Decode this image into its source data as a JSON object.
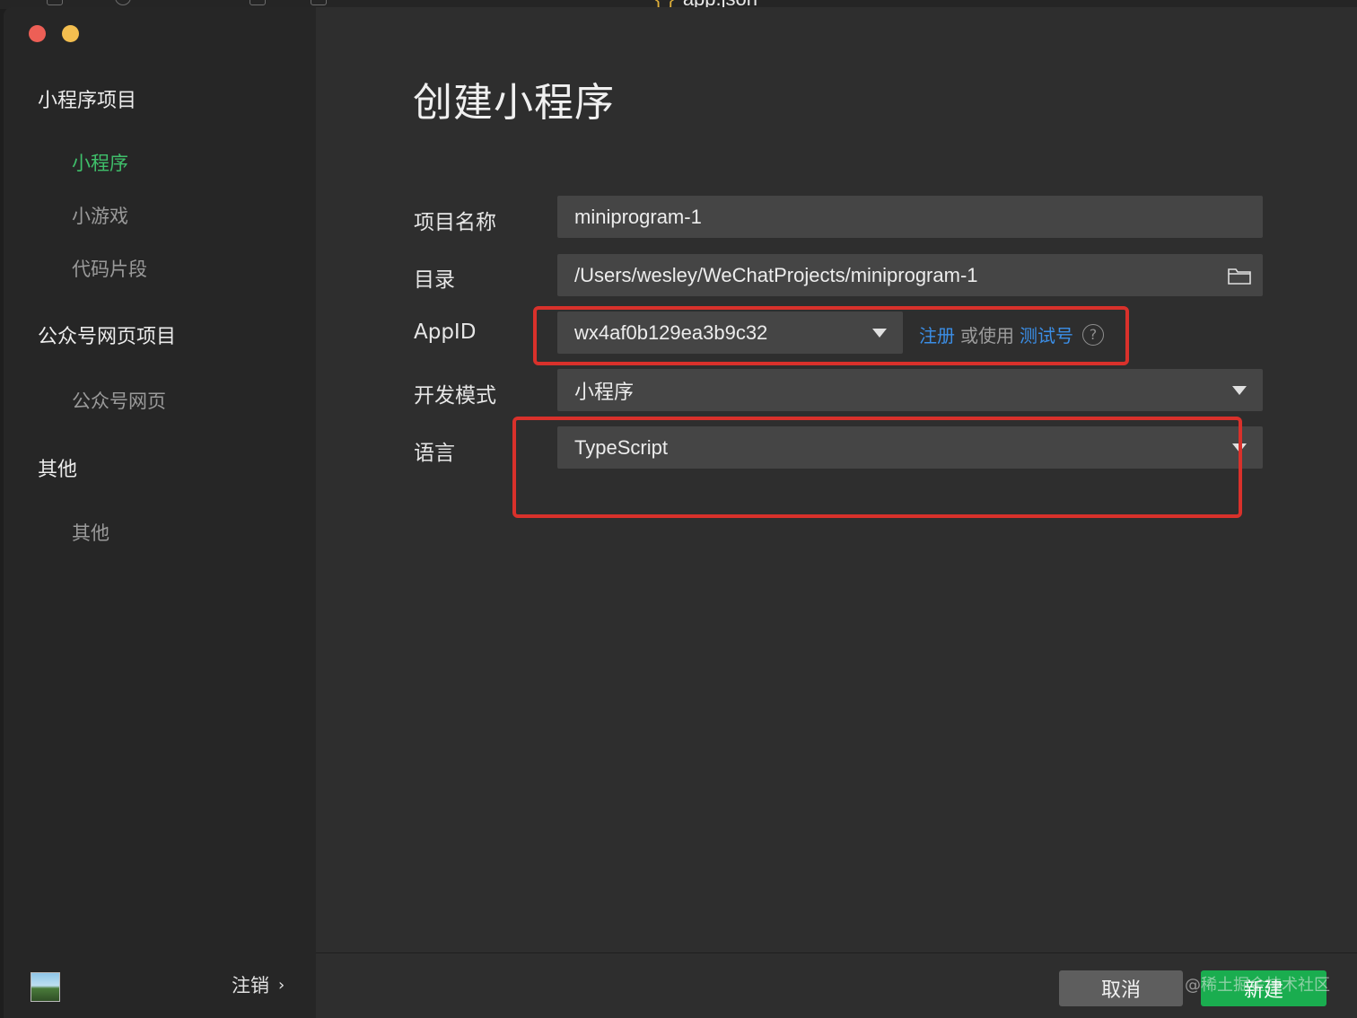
{
  "topbar": {
    "tab_label": "app.json"
  },
  "window_controls": {
    "close_color": "#ed5f56",
    "minimize_color": "#f3be4f"
  },
  "sidebar": {
    "groups": [
      {
        "title": "小程序项目",
        "items": [
          {
            "label": "小程序",
            "active": true
          },
          {
            "label": "小游戏",
            "active": false
          },
          {
            "label": "代码片段",
            "active": false
          }
        ]
      },
      {
        "title": "公众号网页项目",
        "items": [
          {
            "label": "公众号网页",
            "active": false
          }
        ]
      },
      {
        "title": "其他",
        "items": [
          {
            "label": "其他",
            "active": false
          }
        ]
      }
    ],
    "logout_label": "注销",
    "active_color": "#3fbf6a"
  },
  "main": {
    "title": "创建小程序",
    "form": {
      "project_name": {
        "label": "项目名称",
        "value": "miniprogram-1"
      },
      "directory": {
        "label": "目录",
        "value": "/Users/wesley/WeChatProjects/miniprogram-1"
      },
      "appid": {
        "label": "AppID",
        "value": "wx4af0b129ea3b9c32",
        "register_link": "注册",
        "or_use_text": "或使用",
        "test_account_link": "测试号",
        "help_icon": "question-circle-icon"
      },
      "dev_mode": {
        "label": "开发模式",
        "value": "小程序"
      },
      "language": {
        "label": "语言",
        "value": "TypeScript"
      }
    }
  },
  "footer": {
    "cancel_label": "取消",
    "create_label": "新建",
    "watermark": "@稀土掘金技术社区"
  },
  "colors": {
    "link": "#3b8ee6",
    "primary_button": "#1aad4f",
    "highlight_border": "#d9312b"
  }
}
